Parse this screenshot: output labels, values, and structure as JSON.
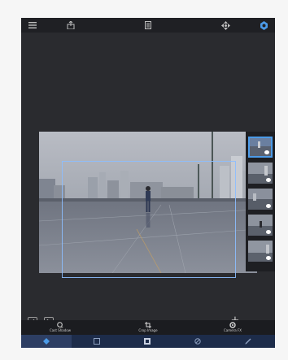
{
  "toolbar": {
    "icons": [
      "menu-icon",
      "share-icon",
      "document-icon",
      "move-icon",
      "settings-icon"
    ]
  },
  "layers": {
    "thumbnails": [
      "layer-1",
      "layer-2",
      "layer-3",
      "layer-4",
      "layer-5"
    ],
    "selected_index": 0
  },
  "canvas": {
    "add_layer_label": "Add Layer"
  },
  "actions": {
    "items": [
      {
        "label": "Cast Shadow",
        "icon": "shadow-icon"
      },
      {
        "label": "Crop Image",
        "icon": "crop-icon"
      },
      {
        "label": "Camera FX",
        "icon": "camera-fx-icon"
      }
    ]
  },
  "tabs": {
    "items": [
      "layers-tab",
      "adjust-tab",
      "effects-tab",
      "brush-tab",
      "draw-tab"
    ],
    "active_index": 0
  },
  "colors": {
    "background": "#2a2b2f",
    "accent": "#4c9be8",
    "tab_bar": "#1d2c4a"
  }
}
